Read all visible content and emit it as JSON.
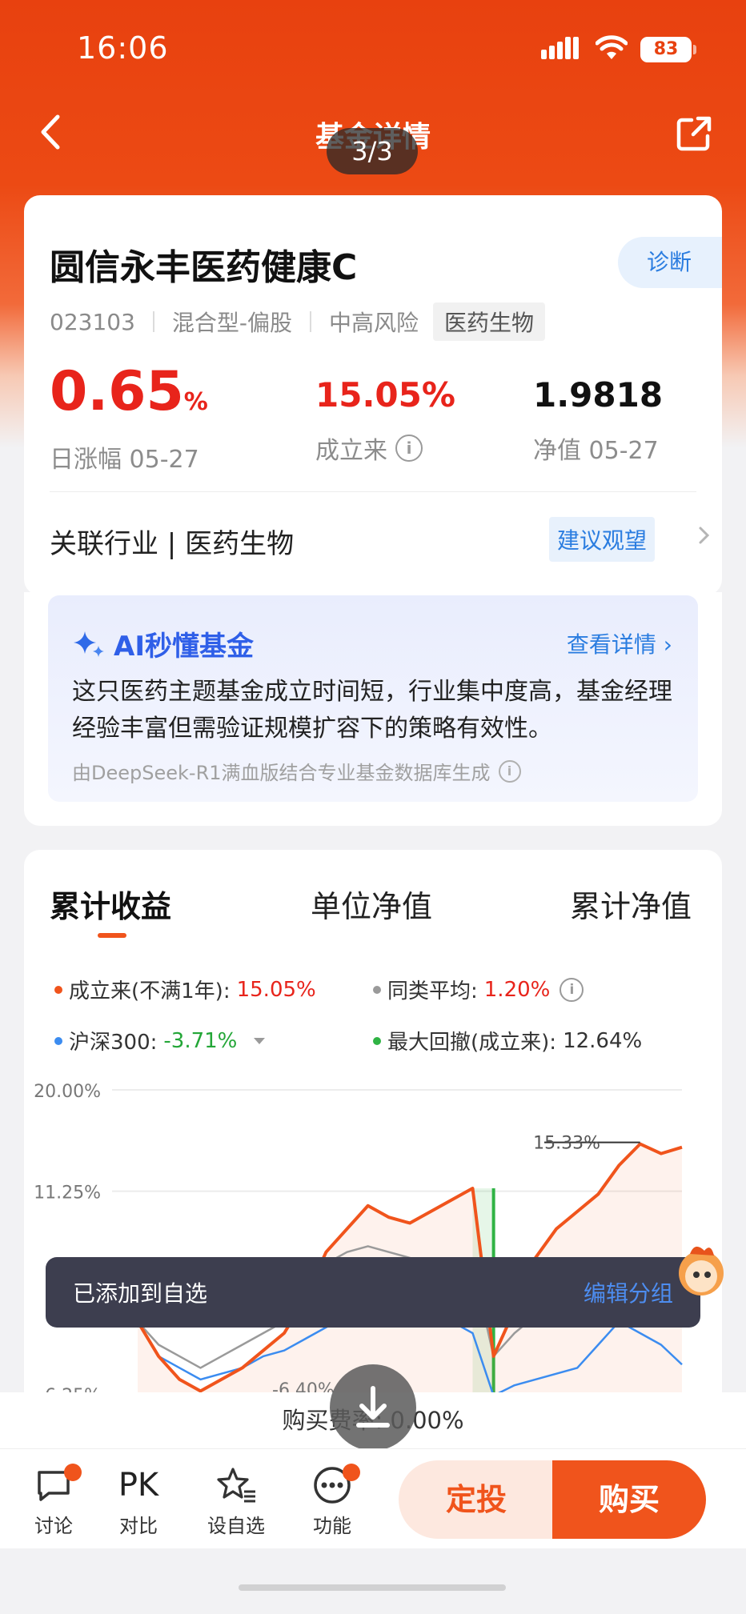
{
  "status": {
    "time": "16:06",
    "battery": "83"
  },
  "nav": {
    "title": "基金详情",
    "page_indicator": "3/3"
  },
  "fund": {
    "name": "圆信永丰医药健康C",
    "diagnose": "诊断",
    "code": "023103",
    "type": "混合型-偏股",
    "risk": "中高风险",
    "sector_tag": "医药生物",
    "daily_change": "0.65",
    "daily_change_unit": "%",
    "daily_change_label": "日涨幅 05-27",
    "since_inception": "15.05%",
    "since_inception_label": "成立来",
    "nav": "1.9818",
    "nav_label": "净值 05-27",
    "industry": "关联行业 | 医药生物",
    "advice": "建议观望"
  },
  "ai": {
    "title": "AI秒懂基金",
    "more": "查看详情",
    "summary": "这只医药主题基金成立时间短，行业集中度高，基金经理经验丰富但需验证规模扩容下的策略有效性。",
    "footer": "由DeepSeek-R1满血版结合专业基金数据库生成"
  },
  "tabs": [
    "累计收益",
    "单位净值",
    "累计净值"
  ],
  "legend": {
    "since_label": "成立来(不满1年):",
    "since_value": "15.05%",
    "peer_label": "同类平均:",
    "peer_value": "1.20%",
    "hs300_label": "沪深300:",
    "hs300_value": "-3.71%",
    "drawdown_label": "最大回撤(成立来):",
    "drawdown_value": "12.64%",
    "colors": {
      "fund": "#f0541c",
      "peer": "#9a9a9a",
      "hs300": "#3b8cf0",
      "drawdown": "#2fb344"
    }
  },
  "chart_data": {
    "type": "line",
    "ytick_labels": [
      "20.00%",
      "11.25%",
      "-6.25%"
    ],
    "ylim": [
      -6.25,
      20.0
    ],
    "annotations": [
      "15.33%",
      "-6.40%"
    ],
    "series": [
      {
        "name": "成立来",
        "values": [
          0.0,
          -3.0,
          -5.0,
          -6.0,
          -5.0,
          -4.0,
          -2.5,
          -1.0,
          2.0,
          6.0,
          8.0,
          10.0,
          9.0,
          8.5,
          9.5,
          10.5,
          11.5,
          -3.0,
          1.0,
          5.5,
          8.0,
          9.5,
          11.0,
          13.5,
          15.33,
          14.5,
          15.05
        ]
      },
      {
        "name": "同类平均",
        "values": [
          0.0,
          -2.0,
          -3.0,
          -4.0,
          -3.0,
          -2.0,
          -1.0,
          0.0,
          3.0,
          5.0,
          6.0,
          6.5,
          6.0,
          5.5,
          5.0,
          4.5,
          5.0,
          -3.0,
          -1.0,
          0.5,
          1.0,
          1.5,
          1.0,
          1.5,
          1.8,
          1.4,
          1.2
        ]
      },
      {
        "name": "沪深300",
        "values": [
          0.0,
          -3.0,
          -4.0,
          -5.0,
          -4.5,
          -4.0,
          -3.0,
          -2.5,
          -1.5,
          -0.5,
          0.5,
          1.5,
          1.0,
          0.5,
          1.0,
          0.0,
          -1.0,
          -6.4,
          -5.5,
          -5.0,
          -4.5,
          -4.0,
          -2.0,
          0.0,
          -1.0,
          -2.0,
          -3.71
        ]
      }
    ]
  },
  "toast": {
    "message": "已添加到自选",
    "action": "编辑分组"
  },
  "fee": "购买费率: 0.00%",
  "bottom": {
    "discuss": "讨论",
    "pk": "PK",
    "compare": "对比",
    "watch": "设自选",
    "func": "功能",
    "dingtou": "定投",
    "buy": "购买"
  }
}
